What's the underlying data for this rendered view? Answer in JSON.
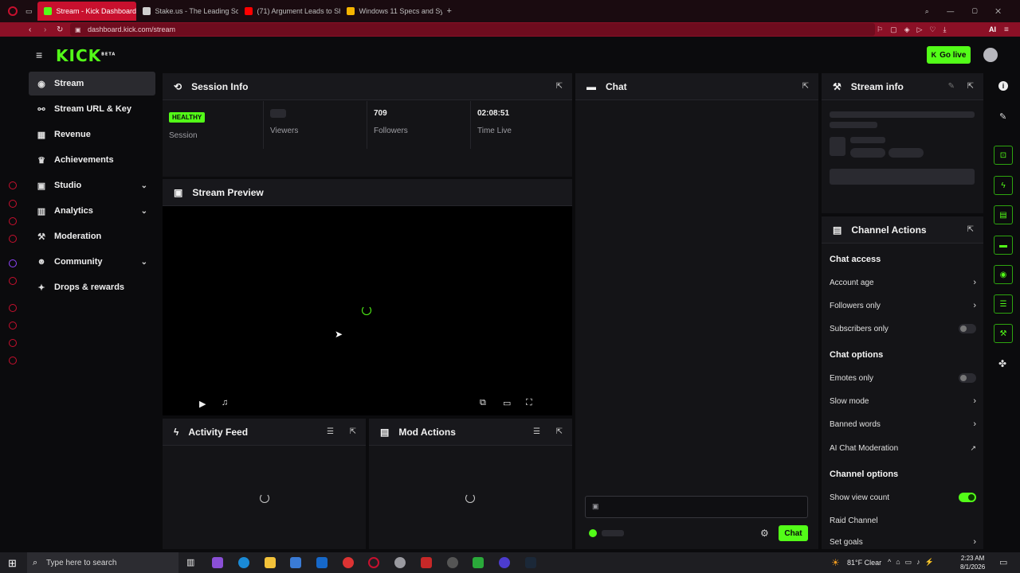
{
  "browser": {
    "tabs": [
      {
        "title": "Stream - Kick Dashboard",
        "color": "#53fc18",
        "active": true
      },
      {
        "title": "Stake.us - The Leading So",
        "color": "#cfcfcf",
        "active": false
      },
      {
        "title": "(71) Argument Leads to Sh",
        "color": "#ff0000",
        "active": false
      },
      {
        "title": "Windows 11 Specs and Sys",
        "color": "#f5b400",
        "active": false
      }
    ],
    "new_tab": "+",
    "url": "dashboard.kick.com/stream",
    "ai_label": "AI"
  },
  "header": {
    "logo": "KICK",
    "logo_tag": "BETA",
    "go_live_label": "Go live"
  },
  "nav": {
    "items": [
      {
        "label": "Stream",
        "icon": "broadcast-icon",
        "glyph": "◉"
      },
      {
        "label": "Stream URL & Key",
        "icon": "link-icon",
        "glyph": "⚯"
      },
      {
        "label": "Revenue",
        "icon": "chart-icon",
        "glyph": "▦"
      },
      {
        "label": "Achievements",
        "icon": "trophy-icon",
        "glyph": "♛"
      },
      {
        "label": "Studio",
        "icon": "studio-icon",
        "glyph": "▣"
      },
      {
        "label": "Analytics",
        "icon": "analytics-icon",
        "glyph": "▥"
      },
      {
        "label": "Moderation",
        "icon": "hammer-icon",
        "glyph": "⚒"
      },
      {
        "label": "Community",
        "icon": "people-icon",
        "glyph": "☻"
      },
      {
        "label": "Drops & rewards",
        "icon": "gift-icon",
        "glyph": "✦"
      }
    ]
  },
  "session_info": {
    "title": "Session Info",
    "stats": [
      {
        "value": "HEALTHY",
        "label": "Session"
      },
      {
        "value": "",
        "label": "Viewers"
      },
      {
        "value": "709",
        "label": "Followers"
      },
      {
        "value": "02:08:51",
        "label": "Time Live"
      }
    ]
  },
  "stream_preview": {
    "title": "Stream Preview"
  },
  "activity_feed": {
    "title": "Activity Feed"
  },
  "mod_actions": {
    "title": "Mod Actions"
  },
  "chat": {
    "title": "Chat",
    "send_label": "Chat"
  },
  "stream_info": {
    "title": "Stream info"
  },
  "channel_actions": {
    "title": "Channel Actions",
    "sections": [
      {
        "heading": "Chat access",
        "rows": [
          {
            "label": "Account age",
            "control": "chevron"
          },
          {
            "label": "Followers only",
            "control": "chevron"
          },
          {
            "label": "Subscribers only",
            "control": "toggle",
            "on": false
          }
        ]
      },
      {
        "heading": "Chat options",
        "rows": [
          {
            "label": "Emotes only",
            "control": "toggle",
            "on": false
          },
          {
            "label": "Slow mode",
            "control": "chevron"
          },
          {
            "label": "Banned words",
            "control": "chevron"
          },
          {
            "label": "AI Chat Moderation",
            "control": "external"
          }
        ]
      },
      {
        "heading": "Channel options",
        "rows": [
          {
            "label": "Show view count",
            "control": "toggle",
            "on": true
          },
          {
            "label": "Raid Channel",
            "control": "none"
          },
          {
            "label": "Set goals",
            "control": "chevron"
          }
        ]
      }
    ]
  },
  "taskbar": {
    "search_placeholder": "Type here to search",
    "weather": "81°F Clear",
    "time": "2:23 AM",
    "date": "8/1/2026"
  },
  "colors": {
    "accent": "#53fc18",
    "browser": "#8b1026"
  }
}
